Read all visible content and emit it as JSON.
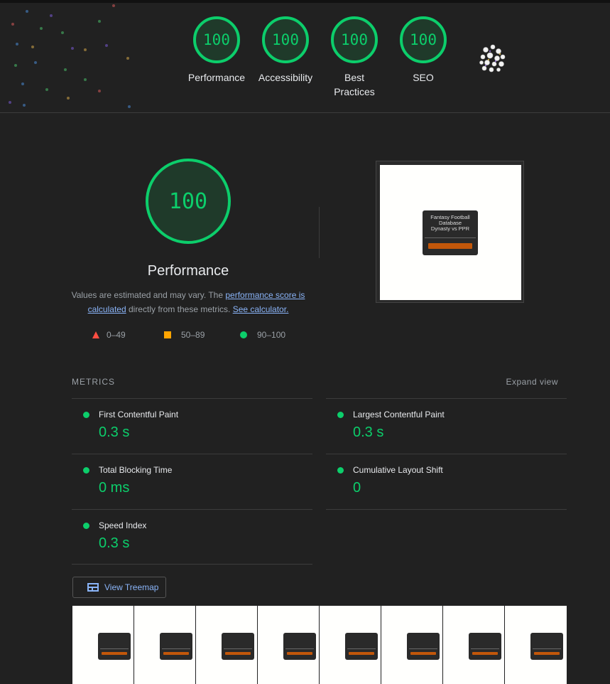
{
  "top_scores": [
    {
      "score": "100",
      "label": "Performance"
    },
    {
      "score": "100",
      "label": "Accessibility"
    },
    {
      "score": "100",
      "label": "Best Practices"
    },
    {
      "score": "100",
      "label": "SEO"
    }
  ],
  "main": {
    "score": "100",
    "title": "Performance",
    "desc_prefix": "Values are estimated and may vary. The ",
    "desc_link1": "performance score is calculated",
    "desc_middle": " directly from these metrics. ",
    "desc_link2": "See calculator."
  },
  "legend": {
    "fail": "0–49",
    "average": "50–89",
    "pass": "90–100"
  },
  "screenshot_card": {
    "title_line1": "Fantasy Football",
    "title_line2": "Database",
    "subtitle": "Dynasty vs PPR"
  },
  "metrics": {
    "heading": "METRICS",
    "expand": "Expand view",
    "items": [
      {
        "name": "First Contentful Paint",
        "value": "0.3 s"
      },
      {
        "name": "Largest Contentful Paint",
        "value": "0.3 s"
      },
      {
        "name": "Total Blocking Time",
        "value": "0 ms"
      },
      {
        "name": "Cumulative Layout Shift",
        "value": "0"
      },
      {
        "name": "Speed Index",
        "value": "0.3 s"
      }
    ]
  },
  "treemap_button": "View Treemap",
  "colors": {
    "pass": "#0cce6b",
    "average": "#ffa400",
    "fail": "#ff4e42",
    "link": "#8ab4f8",
    "background": "#212121"
  }
}
